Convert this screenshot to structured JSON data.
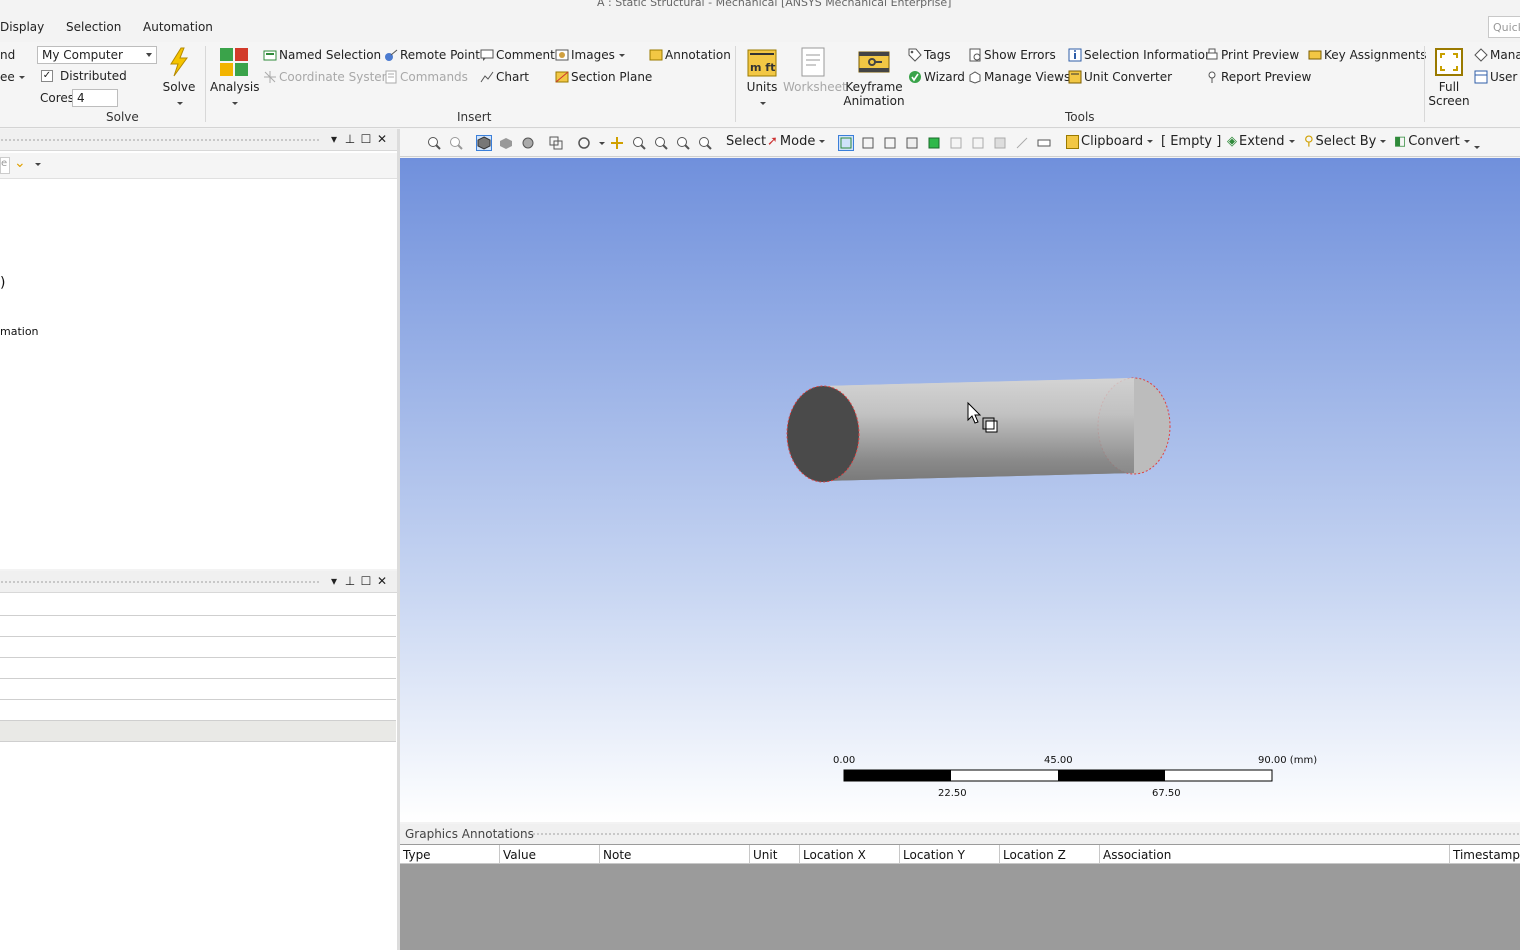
{
  "window": {
    "title": "A : Static Structural - Mechanical [ANSYS Mechanical Enterprise]",
    "quick_search_placeholder": "Quick"
  },
  "menu": {
    "items": [
      "Display",
      "Selection",
      "Automation"
    ],
    "partial_left": "nd",
    "partial_left2": "ee"
  },
  "ribbon": {
    "solve": {
      "group_label": "Solve",
      "computer": "My Computer",
      "distributed_label": "Distributed",
      "distributed_checked": true,
      "cores_label": "Cores",
      "cores_value": "4",
      "solve_label": "Solve",
      "analysis_label": "Analysis"
    },
    "insert": {
      "group_label": "Insert",
      "named_selection": "Named Selection",
      "remote_point": "Remote Point",
      "comment": "Comment",
      "images": "Images",
      "annotation": "Annotation",
      "coordinate_system": "Coordinate System",
      "commands": "Commands",
      "chart": "Chart",
      "section_plane": "Section Plane"
    },
    "tools": {
      "group_label": "Tools",
      "units": "Units",
      "worksheet": "Worksheet",
      "keyframe": "Keyframe",
      "animation": "Animation",
      "tags": "Tags",
      "wizard": "Wizard",
      "show_errors": "Show Errors",
      "manage_views": "Manage Views",
      "selection_information": "Selection Information",
      "unit_converter": "Unit Converter",
      "print_preview": "Print Preview",
      "report_preview": "Report Preview",
      "key_assignments": "Key Assignments"
    },
    "view": {
      "full": "Full",
      "screen": "Screen",
      "manage": "Mana",
      "user_defined": "User D"
    },
    "units_icon_text": "m ft"
  },
  "left_panel": {
    "filter_text": "e",
    "tree_fragment_1": ")",
    "tree_fragment_2": "mation"
  },
  "graphics_toolbar": {
    "select": "Select",
    "mode": "Mode",
    "clipboard": "Clipboard",
    "empty": "[ Empty ]",
    "extend": "Extend",
    "select_by": "Select By",
    "convert": "Convert"
  },
  "scale_bar": {
    "top_labels": [
      "0.00",
      "45.00",
      "90.00 (mm)"
    ],
    "bottom_labels": [
      "22.50",
      "67.50"
    ]
  },
  "graphics_annotations": {
    "title": "Graphics Annotations",
    "columns": [
      "Type",
      "Value",
      "Note",
      "Unit",
      "Location X",
      "Location Y",
      "Location Z",
      "Association",
      "Timestamp"
    ]
  },
  "colors": {
    "ribbon_bg": "#f5f5f5",
    "viewport_top": "#7090dc",
    "viewport_bottom": "#ffffff",
    "selection_accent": "#3b7fd9",
    "edge_highlight": "#e04040"
  }
}
